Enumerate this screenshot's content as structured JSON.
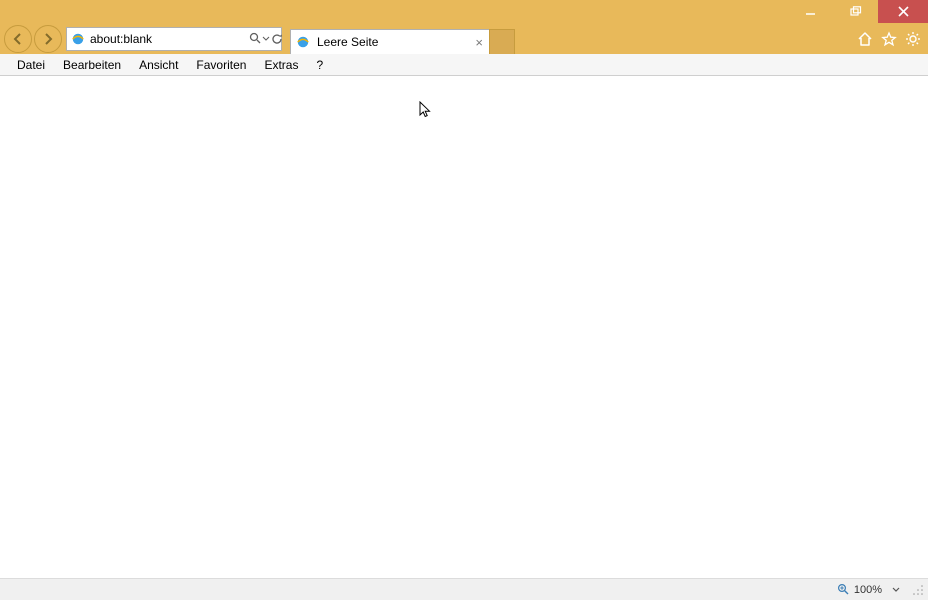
{
  "url": "about:blank",
  "tab": {
    "title": "Leere Seite"
  },
  "menu": {
    "items": [
      "Datei",
      "Bearbeiten",
      "Ansicht",
      "Favoriten",
      "Extras",
      "?"
    ]
  },
  "status": {
    "zoom": "100%"
  }
}
